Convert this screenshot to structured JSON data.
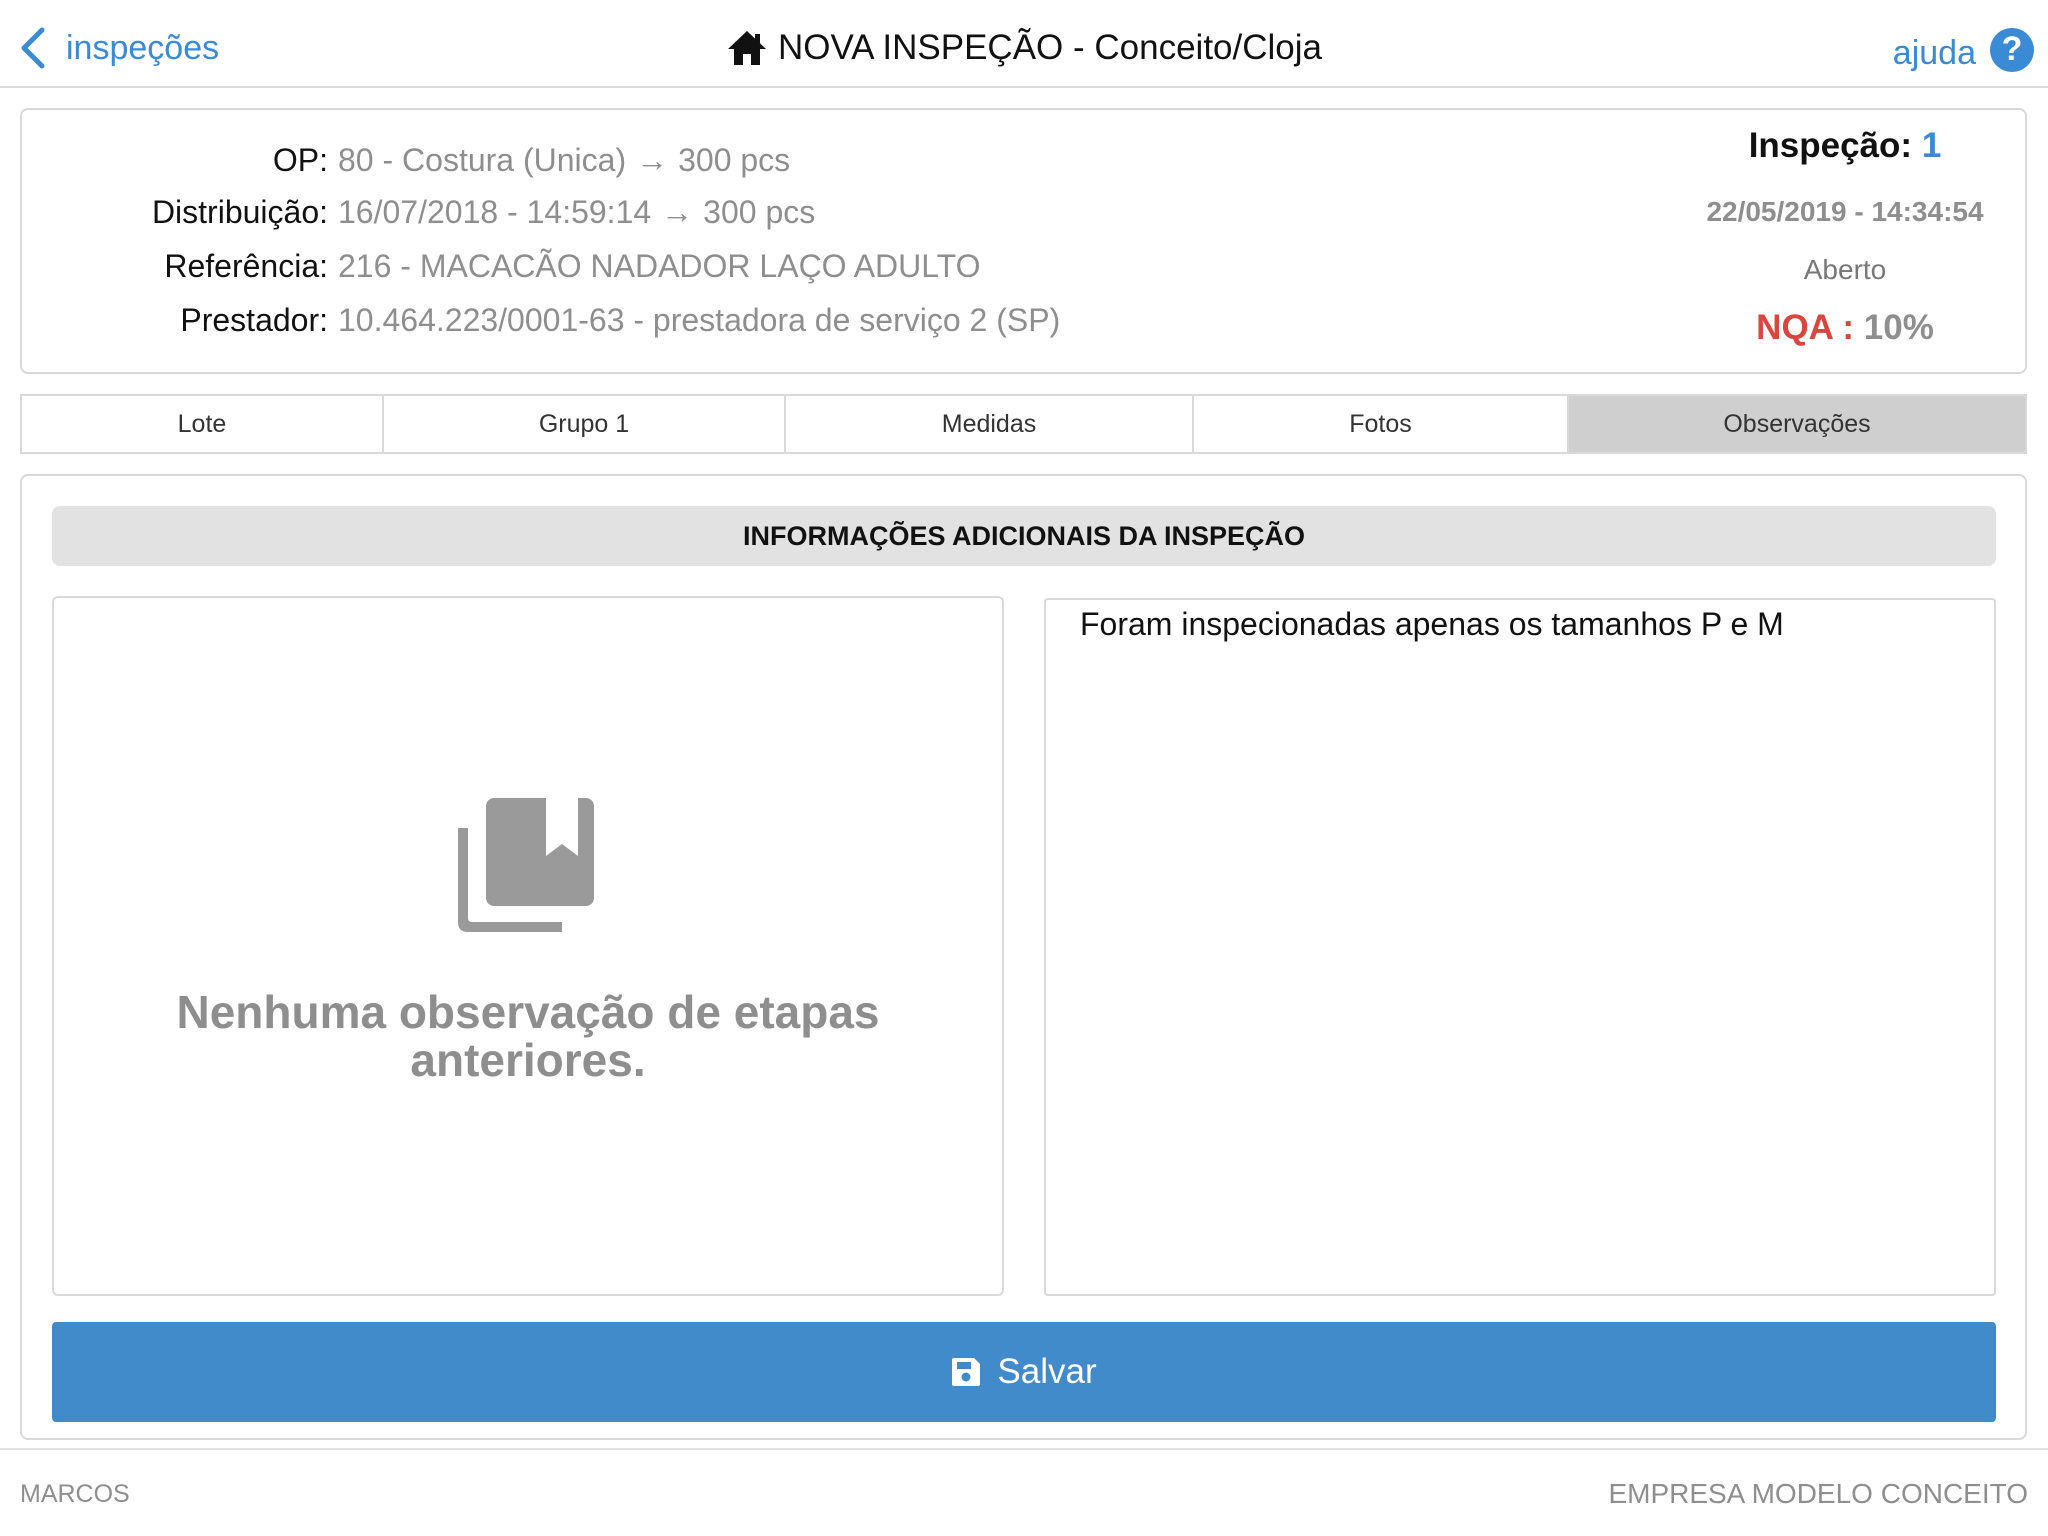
{
  "header": {
    "back_label": "inspeções",
    "title": "NOVA INSPEÇÃO - Conceito/Cloja",
    "help_label": "ajuda",
    "help_glyph": "?"
  },
  "info": {
    "op_label": "OP:",
    "op_value": "80 - Costura (Unica)",
    "op_qty": "300 pcs",
    "dist_label": "Distribuição:",
    "dist_value": "16/07/2018 - 14:59:14",
    "dist_qty": "300 pcs",
    "ref_label": "Referência:",
    "ref_value": "216 - MACACÃO NADADOR LAÇO ADULTO",
    "prest_label": "Prestador:",
    "prest_value": "10.464.223/0001-63 - prestadora de serviço 2 (SP)",
    "arrow": "→",
    "inspecao_label": "Inspeção:",
    "inspecao_num": "1",
    "datetime": "22/05/2019 - 14:34:54",
    "status": "Aberto",
    "nqa_label": "NQA :",
    "nqa_value": "10%"
  },
  "tabs": [
    {
      "label": "Lote"
    },
    {
      "label": "Grupo 1"
    },
    {
      "label": "Medidas"
    },
    {
      "label": "Fotos"
    },
    {
      "label": "Observações",
      "active": true
    }
  ],
  "section": {
    "title": "INFORMAÇÕES ADICIONAIS DA INSPEÇÃO",
    "empty_message": "Nenhuma observação de etapas anteriores.",
    "observation_text": "Foram inspecionadas apenas os tamanhos P e M",
    "save_label": "Salvar"
  },
  "footer": {
    "user": "MARCOS",
    "company": "EMPRESA MODELO CONCEITO"
  },
  "colors": {
    "link_blue": "#3a8ad6",
    "button_blue": "#418bcb",
    "nqa_red": "#d9463e",
    "muted_gray": "#8e8e8e"
  }
}
